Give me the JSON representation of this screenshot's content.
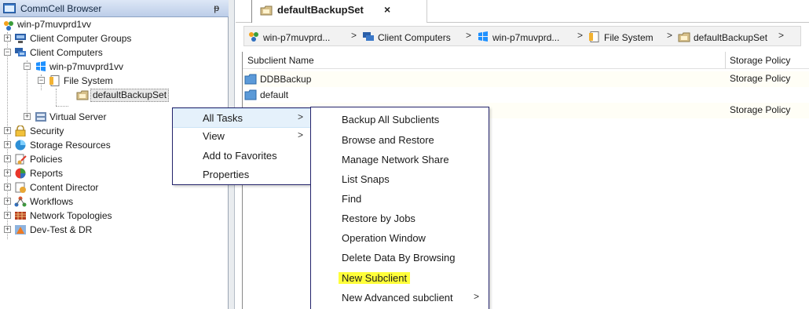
{
  "left_pane": {
    "title": "CommCell Browser",
    "pin": "ᵽ",
    "tree": {
      "root": "win-p7muvprd1vv",
      "client_computer_groups": "Client Computer Groups",
      "client_computers": "Client Computers",
      "client": "win-p7muvprd1vv",
      "file_system": "File System",
      "backupset": "defaultBackupSet",
      "virtual_server": "Virtual Server",
      "security": "Security",
      "storage_resources": "Storage Resources",
      "policies": "Policies",
      "reports": "Reports",
      "content_director": "Content Director",
      "workflows": "Workflows",
      "network_topologies": "Network Topologies",
      "dev_test_dr": "Dev-Test & DR"
    }
  },
  "tab": {
    "title": "defaultBackupSet",
    "close": "×"
  },
  "breadcrumb": {
    "items": [
      "win-p7muvprd...",
      "Client Computers",
      "win-p7muvprd...",
      "File System",
      "defaultBackupSet"
    ],
    "separator": ">"
  },
  "grid": {
    "columns": [
      "Subclient Name",
      "Storage Policy"
    ],
    "rows": [
      {
        "name": "DDBBackup",
        "policy": "Storage Policy"
      },
      {
        "name": "default",
        "policy": ""
      },
      {
        "name": "",
        "policy": "Storage Policy"
      }
    ]
  },
  "context_menu": {
    "items": [
      {
        "label": "All Tasks",
        "arrow": ">"
      },
      {
        "label": "View",
        "arrow": ">"
      },
      {
        "label": "Add to Favorites",
        "arrow": ""
      },
      {
        "label": "Properties",
        "arrow": ""
      }
    ]
  },
  "submenu": {
    "items": [
      {
        "label": "Backup All Subclients",
        "arrow": ""
      },
      {
        "label": "Browse and Restore",
        "arrow": ""
      },
      {
        "label": "Manage Network Share",
        "arrow": ""
      },
      {
        "label": "List Snaps",
        "arrow": ""
      },
      {
        "label": "Find",
        "arrow": ""
      },
      {
        "label": "Restore by Jobs",
        "arrow": ""
      },
      {
        "label": "Operation Window",
        "arrow": ""
      },
      {
        "label": "Delete Data By Browsing",
        "arrow": ""
      },
      {
        "label": "New Subclient",
        "arrow": ""
      },
      {
        "label": "New Advanced subclient",
        "arrow": ">"
      }
    ]
  },
  "colors": {
    "highlight_yellow": "#ffff3a",
    "menu_border": "#23236b",
    "menu_hover": "#e5f1fb",
    "title_bar": "#bccde8"
  }
}
